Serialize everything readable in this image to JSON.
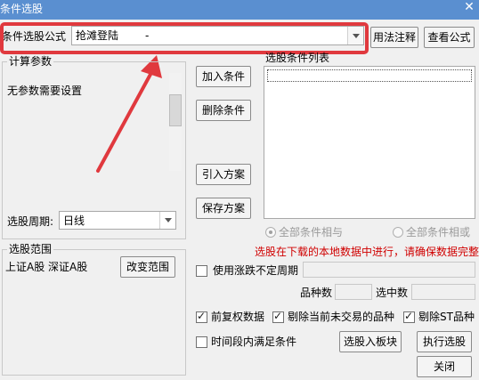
{
  "window": {
    "title": "条件选股",
    "close_glyph": "✕"
  },
  "formula": {
    "label": "条件选股公式",
    "value": "抢滩登陆",
    "dash": "-",
    "help_button": "用法注释",
    "view_button": "查看公式"
  },
  "params": {
    "legend": "计算参数",
    "message": "无参数需要设置",
    "period_label": "选股周期:",
    "period_value": "日线"
  },
  "range": {
    "legend": "选股范围",
    "markets": "上证A股  深证A股",
    "change_button": "改变范围"
  },
  "actions": {
    "add": "加入条件",
    "delete": "删除条件",
    "import": "引入方案",
    "save": "保存方案"
  },
  "conditions": {
    "list_label": "选股条件列表",
    "and_label": "全部条件相与",
    "or_label": "全部条件相或",
    "warning": "选股在下载的本地数据中进行，请确保数据完整",
    "warning_color": "#d00000",
    "annotation_color": "#e0393e"
  },
  "options": {
    "irregular_period": "使用涨跌不定周期",
    "count_label": "品种数",
    "selected_label": "选中数",
    "forward_adjust": "前复权数据",
    "exclude_untraded": "剔除当前未交易的品种",
    "exclude_st": "剔除ST品种",
    "time_range": "时间段内满足条件"
  },
  "buttons": {
    "to_block": "选股入板块",
    "execute": "执行选股",
    "close": "关闭"
  }
}
